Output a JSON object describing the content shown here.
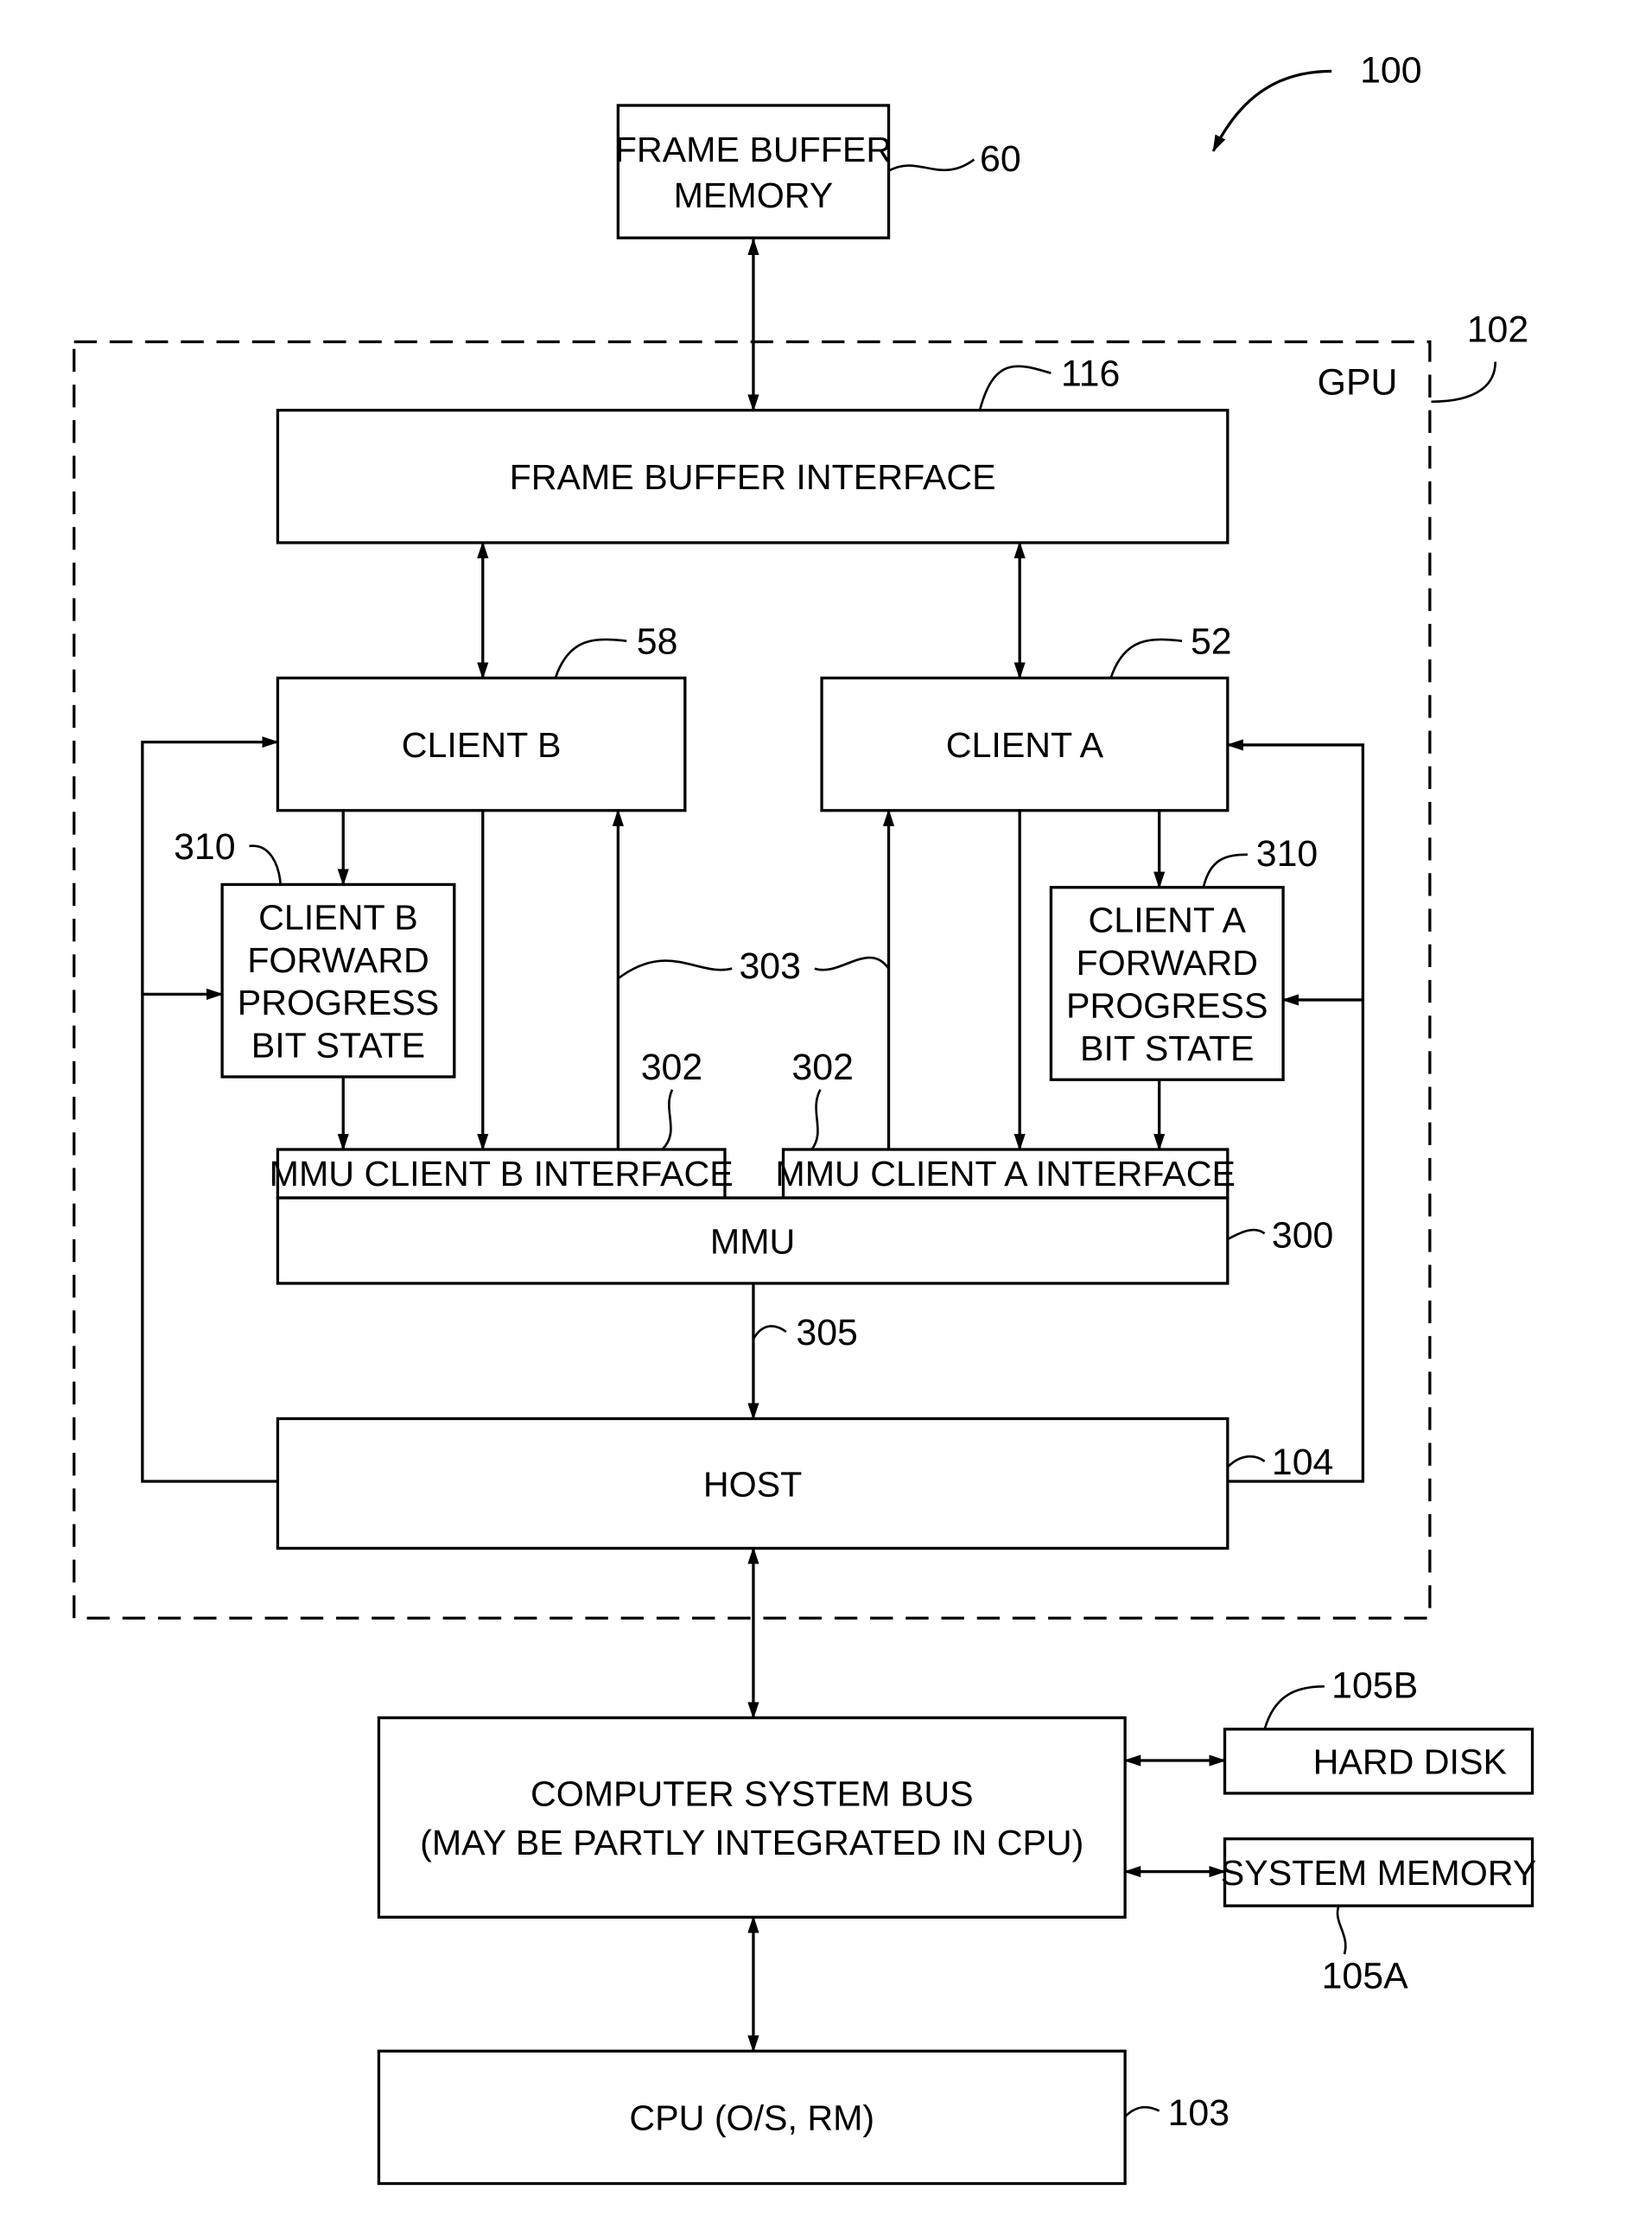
{
  "figure": {
    "figure_ref": "100",
    "gpu_label": "GPU",
    "gpu_ref": "102",
    "blocks": {
      "frame_buffer_memory": {
        "lines": [
          "FRAME BUFFER",
          "MEMORY"
        ],
        "ref": "60"
      },
      "frame_buffer_interface": {
        "lines": [
          "FRAME BUFFER INTERFACE"
        ],
        "ref": "116"
      },
      "client_b": {
        "lines": [
          "CLIENT B"
        ],
        "ref": "58"
      },
      "client_a": {
        "lines": [
          "CLIENT A"
        ],
        "ref": "52"
      },
      "client_b_fp": {
        "lines": [
          "CLIENT B",
          "FORWARD",
          "PROGRESS",
          "BIT STATE"
        ],
        "ref": "310"
      },
      "client_a_fp": {
        "lines": [
          "CLIENT A",
          "FORWARD",
          "PROGRESS",
          "BIT STATE"
        ],
        "ref": "310"
      },
      "mmu_client_b_interface": {
        "lines": [
          "MMU CLIENT B INTERFACE"
        ],
        "ref": "302"
      },
      "mmu_client_a_interface": {
        "lines": [
          "MMU CLIENT A INTERFACE"
        ],
        "ref": "302"
      },
      "mmu": {
        "lines": [
          "MMU"
        ],
        "ref": "300"
      },
      "host": {
        "lines": [
          "HOST"
        ],
        "ref": "104"
      },
      "system_bus": {
        "lines": [
          "COMPUTER SYSTEM BUS",
          "(MAY BE PARTLY INTEGRATED IN CPU)"
        ]
      },
      "hard_disk": {
        "lines": [
          "HARD DISK"
        ],
        "ref": "105B"
      },
      "system_memory": {
        "lines": [
          "SYSTEM MEMORY"
        ],
        "ref": "105A"
      },
      "cpu": {
        "lines": [
          "CPU (O/S, RM)"
        ],
        "ref": "103"
      }
    },
    "connection_refs": {
      "client_return_paths": "303",
      "mmu_to_host": "305"
    }
  }
}
